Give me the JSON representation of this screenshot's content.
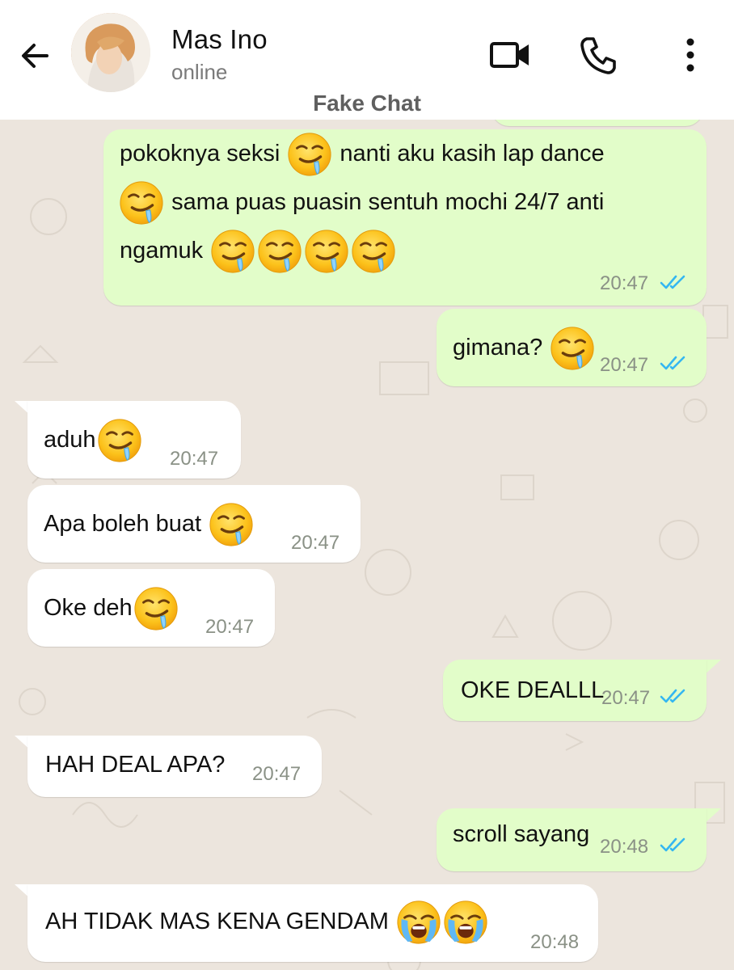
{
  "header": {
    "contact_name": "Mas Ino",
    "status": "online",
    "label": "Fake Chat"
  },
  "theme": {
    "outgoing_bubble": "#e2fdc9",
    "incoming_bubble": "#ffffff",
    "background": "#ece5dd",
    "read_ticks": "#34b7f1"
  },
  "messages": [
    {
      "direction": "outgoing",
      "lines": [
        "pokoknya seksi",
        "nanti aku kasih lap dance",
        "sama puas puasin sentuh mochi 24/7 anti",
        "ngamuk"
      ],
      "time": "20:47",
      "emoji": "drooling-face",
      "read": true
    },
    {
      "direction": "outgoing",
      "text": "gimana?",
      "time": "20:47",
      "emoji": "drooling-face",
      "read": true
    },
    {
      "direction": "incoming",
      "text": "aduh",
      "time": "20:47",
      "emoji": "drooling-face"
    },
    {
      "direction": "incoming",
      "text": "Apa boleh buat",
      "time": "20:47",
      "emoji": "drooling-face"
    },
    {
      "direction": "incoming",
      "text": "Oke deh",
      "time": "20:47",
      "emoji": "drooling-face"
    },
    {
      "direction": "outgoing",
      "text": "OKE DEALLL",
      "time": "20:47",
      "read": true
    },
    {
      "direction": "incoming",
      "text": "HAH DEAL APA?",
      "time": "20:47"
    },
    {
      "direction": "outgoing",
      "text": "scroll sayang",
      "time": "20:48",
      "read": true
    },
    {
      "direction": "incoming",
      "text": "AH TIDAK MAS KENA GENDAM",
      "time": "20:48",
      "emoji": "loudly-crying-face"
    }
  ]
}
